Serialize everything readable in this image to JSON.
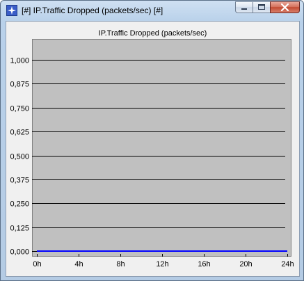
{
  "window": {
    "title": "[#] IP.Traffic Dropped (packets/sec) [#]",
    "icons": {
      "app": "star-app-icon",
      "minimize": "minimize-icon",
      "maximize": "maximize-icon",
      "close": "close-icon"
    }
  },
  "chart_data": {
    "type": "line",
    "title": "IP.Traffic Dropped (packets/sec)",
    "xlabel": "",
    "ylabel": "",
    "x_tick_labels": [
      "0h",
      "4h",
      "8h",
      "12h",
      "16h",
      "20h",
      "24h"
    ],
    "y_tick_labels": [
      "1,000",
      "0,875",
      "0,750",
      "0,625",
      "0,500",
      "0,375",
      "0,250",
      "0,125",
      "0,000"
    ],
    "xlim": [
      0,
      24
    ],
    "ylim": [
      0,
      1
    ],
    "grid": true,
    "series": [
      {
        "x": [
          0,
          24
        ],
        "values": [
          0,
          0
        ],
        "color": "#0000ff"
      }
    ],
    "colors": {
      "plot_background": "#c0c0c0",
      "gridline": "#000000",
      "series": "#0000ff"
    }
  }
}
